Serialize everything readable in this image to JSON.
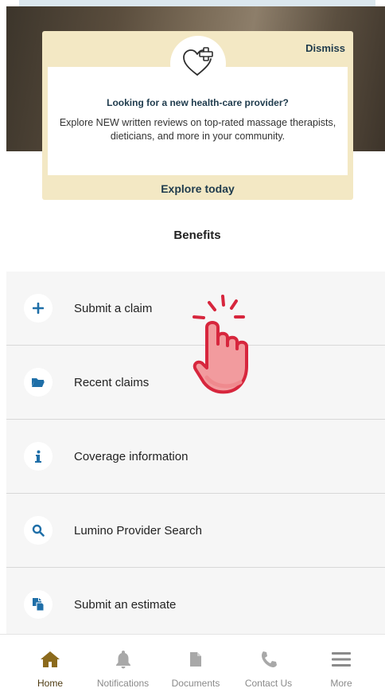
{
  "promo": {
    "dismiss_label": "Dismiss",
    "title": "Looking for a new health-care provider?",
    "body": "Explore NEW written reviews on top-rated massage therapists, dieticians, and more in your community.",
    "cta_label": "Explore today",
    "icon": "heart-plus-icon"
  },
  "benefits": {
    "title": "Benefits",
    "items": [
      {
        "label": "Submit a claim",
        "icon": "plus-icon"
      },
      {
        "label": "Recent claims",
        "icon": "folder-icon"
      },
      {
        "label": "Coverage information",
        "icon": "info-icon"
      },
      {
        "label": "Lumino Provider Search",
        "icon": "search-icon"
      },
      {
        "label": "Submit an estimate",
        "icon": "document-copy-icon"
      }
    ]
  },
  "nav": {
    "items": [
      {
        "label": "Home",
        "icon": "home-icon",
        "active": true
      },
      {
        "label": "Notifications",
        "icon": "bell-icon"
      },
      {
        "label": "Documents",
        "icon": "document-icon"
      },
      {
        "label": "Contact Us",
        "icon": "phone-icon"
      },
      {
        "label": "More",
        "icon": "menu-icon"
      }
    ]
  },
  "colors": {
    "promo_bg": "#f3e8c4",
    "accent_blue": "#1f6fa8",
    "nav_active": "#8b6a1c",
    "hand_fill": "#f29b9e",
    "hand_stroke": "#d7263d"
  }
}
